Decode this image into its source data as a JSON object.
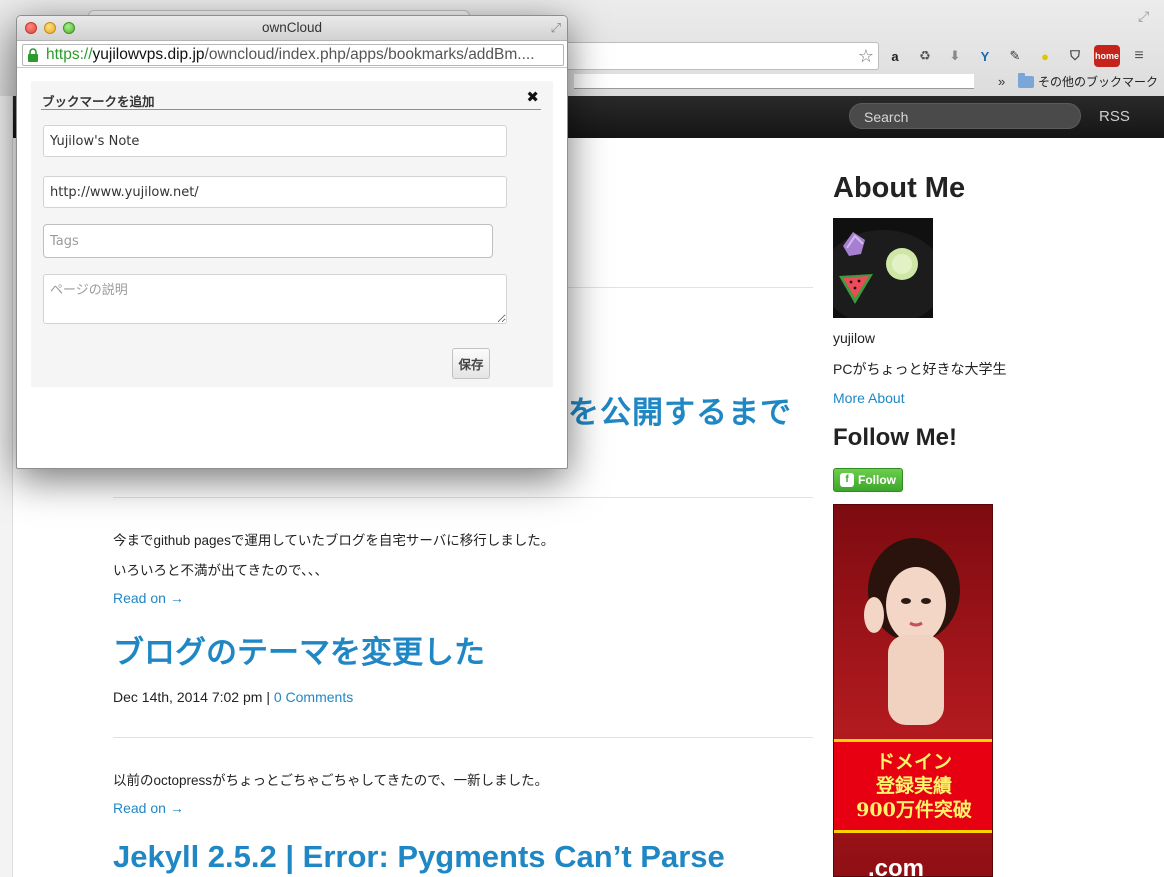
{
  "browser": {
    "bookmarks_folder": "その他のブックマーク",
    "chevron": "»",
    "extensions": [
      "amazon-icon",
      "recycle-icon",
      "download-icon",
      "yammer-icon",
      "evernote-icon",
      "bulb-icon",
      "pocket-icon",
      "home-icon",
      "menu-icon"
    ],
    "home_badge": "home"
  },
  "site": {
    "search_label": "Search",
    "rss_label": "RSS",
    "posts": [
      {
        "title_partial": "を公開するまで",
        "excerpt": [
          "今までgithub pagesで運用していたブログを自宅サーバに移行しました。",
          "いろいろと不満が出てきたので、、、"
        ],
        "read_on": "Read on →"
      },
      {
        "title": "ブログのテーマを変更した",
        "date": "Dec 14th, 2014 7:02 pm",
        "separator": "|",
        "comments": "0 Comments",
        "excerpt": [
          "以前のoctopressがちょっとごちゃごちゃしてきたので、一新しました。"
        ],
        "read_on": "Read on →"
      },
      {
        "title": "Jekyll 2.5.2 | Error: Pygments Can’t Parse"
      }
    ],
    "sidebar": {
      "about_heading": "About Me",
      "username": "yujilow",
      "bio": "PCがちょっと好きな大学生",
      "more_about": "More About",
      "follow_heading": "Follow Me!",
      "follow_button": "Follow",
      "ad": {
        "lines": [
          "ドメイン",
          "登録実績",
          "900万件突破"
        ],
        "suffix": ".com"
      }
    }
  },
  "popup": {
    "window_title": "ownCloud",
    "url_protocol": "https://",
    "url_host": "yujilowvps.dip.jp",
    "url_path": "/owncloud/index.php/apps/bookmarks/addBm....",
    "dialog_title": "ブックマークを追加",
    "close_symbol": "✖",
    "title_value": "Yujilow's Note",
    "url_value": "http://www.yujilow.net/",
    "tags_placeholder": "Tags",
    "description_placeholder": "ページの説明",
    "save_label": "保存"
  },
  "colors": {
    "link": "#1f87c4",
    "nav_bg": "#1b1b1b",
    "secure_url": "#2b9c2b",
    "follow_green": "#3da52b",
    "ad_red": "#e60012"
  }
}
